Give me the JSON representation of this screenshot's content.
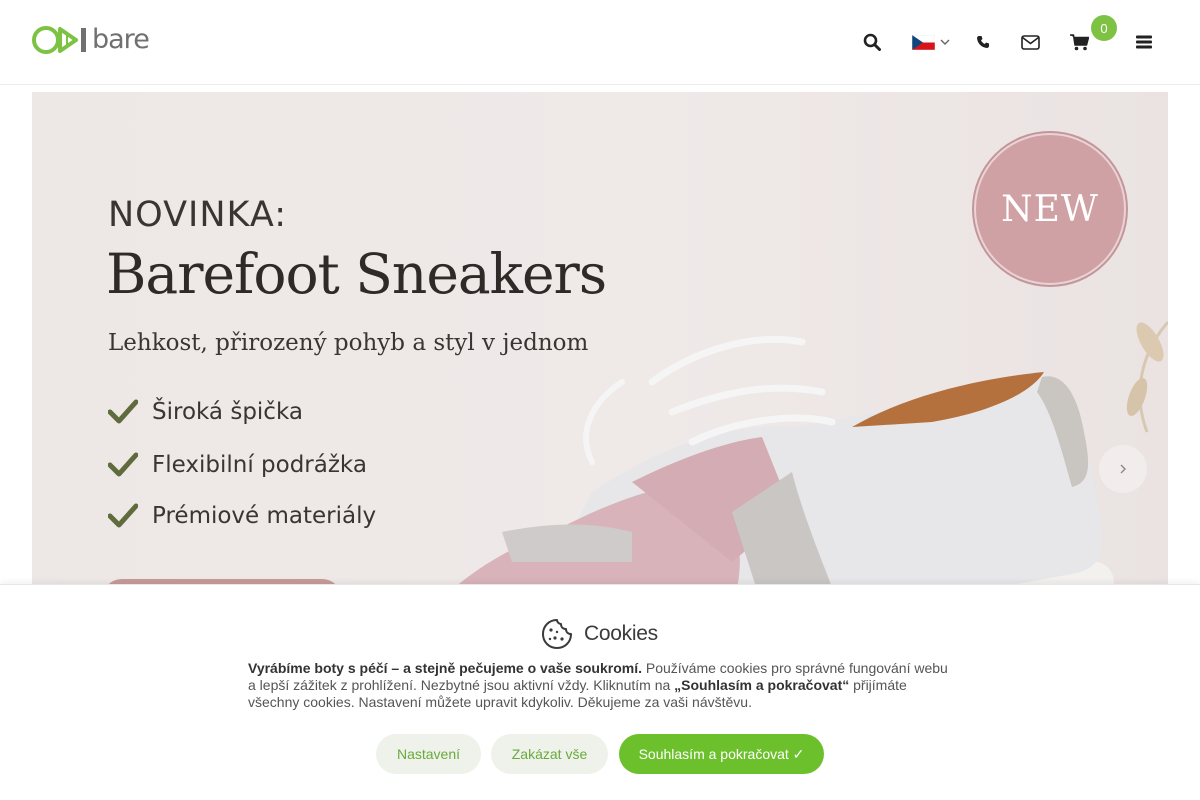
{
  "header": {
    "logo_text": "bare",
    "cart_count": "0",
    "icons": [
      "search-icon",
      "flag-cz-icon",
      "chevron-down-icon",
      "phone-icon",
      "mail-icon",
      "cart-icon",
      "menu-icon"
    ]
  },
  "hero": {
    "kicker": "NOVINKA:",
    "title": "Barefoot Sneakers",
    "subtitle": "Lehkost, přirozený pohyb a styl v jednom",
    "features": [
      "Široká špička",
      "Flexibilní podrážka",
      "Prémiové materiály"
    ],
    "badge": "NEW"
  },
  "cookies": {
    "title": "Cookies",
    "text_strong": "Vyrábíme boty s péčí – a stejně pečujeme o vaše soukromí.",
    "text_1": " Používáme cookies pro správné fungování webu a lepší zážitek z prohlížení. Nezbytné jsou aktivní vždy. Kliknutím na ",
    "text_strong_2": "„Souhlasím a pokračovat“",
    "text_2": " přijímáte všechny cookies. Nastavení můžete upravit kdykoliv. Děkujeme za vaši návštěvu.",
    "btn_settings": "Nastavení",
    "btn_reject": "Zakázat vše",
    "btn_accept": "Souhlasím a pokračovat ✓"
  },
  "colors": {
    "accent_green": "#6cc02c",
    "badge_pink": "#cfa1a5"
  }
}
